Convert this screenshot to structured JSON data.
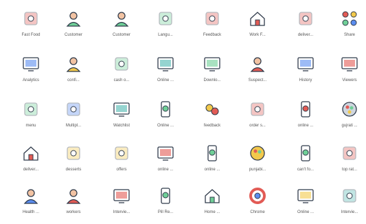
{
  "palette": {
    "stroke": "#2f3a4a",
    "red": "#e25b55",
    "yellow": "#f2c94c",
    "green": "#6fcf97",
    "teal": "#4fb7b0",
    "blue": "#5b8def",
    "gray": "#cfd6df"
  },
  "icons": [
    {
      "label": "Fast Food",
      "icon": "fast-food-icon",
      "accent": "#e25b55"
    },
    {
      "label": "Customer",
      "icon": "customer-icon",
      "accent": "#6fcf97"
    },
    {
      "label": "Customer",
      "icon": "customer-support-icon",
      "accent": "#6fcf97"
    },
    {
      "label": "Langu...",
      "icon": "language-icon",
      "accent": "#6fcf97"
    },
    {
      "label": "Feedback",
      "icon": "feedback-icon",
      "accent": "#e25b55"
    },
    {
      "label": "Work F...",
      "icon": "work-from-home-icon",
      "accent": "#e25b55"
    },
    {
      "label": "deliver...",
      "icon": "delivery-scooter-icon",
      "accent": "#e25b55"
    },
    {
      "label": "Share",
      "icon": "share-icon",
      "accent": "#e25b55"
    },
    {
      "label": "Analytics",
      "icon": "analytics-icon",
      "accent": "#5b8def"
    },
    {
      "label": "confi...",
      "icon": "conference-icon",
      "accent": "#f2c94c"
    },
    {
      "label": "cash o...",
      "icon": "cash-on-delivery-icon",
      "accent": "#6fcf97"
    },
    {
      "label": "Online ...",
      "icon": "online-video-icon",
      "accent": "#4fb7b0"
    },
    {
      "label": "Downlo...",
      "icon": "download-icon",
      "accent": "#6fcf97"
    },
    {
      "label": "Suspect...",
      "icon": "suspect-icon",
      "accent": "#e25b55"
    },
    {
      "label": "History",
      "icon": "history-icon",
      "accent": "#5b8def"
    },
    {
      "label": "Viewers",
      "icon": "viewers-icon",
      "accent": "#e25b55"
    },
    {
      "label": "menu",
      "icon": "menu-icon",
      "accent": "#6fcf97"
    },
    {
      "label": "Multipl...",
      "icon": "multiple-choice-icon",
      "accent": "#5b8def"
    },
    {
      "label": "Watchlist",
      "icon": "watchlist-icon",
      "accent": "#4fb7b0"
    },
    {
      "label": "Online ...",
      "icon": "online-mobile-video-icon",
      "accent": "#6fcf97"
    },
    {
      "label": "feedback",
      "icon": "emoji-feedback-icon",
      "accent": "#f2c94c"
    },
    {
      "label": "order s...",
      "icon": "order-status-icon",
      "accent": "#e25b55"
    },
    {
      "label": "online ...",
      "icon": "online-food-order-icon",
      "accent": "#e25b55"
    },
    {
      "label": "gujrati ...",
      "icon": "gujarati-thali-icon",
      "accent": "#cfd6df"
    },
    {
      "label": "deliver...",
      "icon": "home-delivery-icon",
      "accent": "#e25b55"
    },
    {
      "label": "desserts",
      "icon": "desserts-icon",
      "accent": "#f2c94c"
    },
    {
      "label": "offers",
      "icon": "offers-icon",
      "accent": "#f2c94c"
    },
    {
      "label": "online ...",
      "icon": "online-restaurant-icon",
      "accent": "#e25b55"
    },
    {
      "label": "online ...",
      "icon": "online-payment-icon",
      "accent": "#6fcf97"
    },
    {
      "label": "punjabi...",
      "icon": "punjabi-food-icon",
      "accent": "#f2c94c"
    },
    {
      "label": "can't fo...",
      "icon": "cant-find-icon",
      "accent": "#6fcf97"
    },
    {
      "label": "top rat...",
      "icon": "top-rated-icon",
      "accent": "#e25b55"
    },
    {
      "label": "Health ...",
      "icon": "health-icon",
      "accent": "#5b8def"
    },
    {
      "label": "workers",
      "icon": "workers-icon",
      "accent": "#e25b55"
    },
    {
      "label": "Intervie...",
      "icon": "interview-calendar-icon",
      "accent": "#e25b55"
    },
    {
      "label": "Pill Re...",
      "icon": "pill-reminder-icon",
      "accent": "#6fcf97"
    },
    {
      "label": "Home ...",
      "icon": "home-salad-icon",
      "accent": "#6fcf97"
    },
    {
      "label": "Chrome",
      "icon": "chrome-icon",
      "accent": "#e25b55"
    },
    {
      "label": "Online ...",
      "icon": "online-interview-icon",
      "accent": "#f2c94c"
    },
    {
      "label": "Intervie...",
      "icon": "interview-puzzle-icon",
      "accent": "#4fb7b0"
    }
  ]
}
